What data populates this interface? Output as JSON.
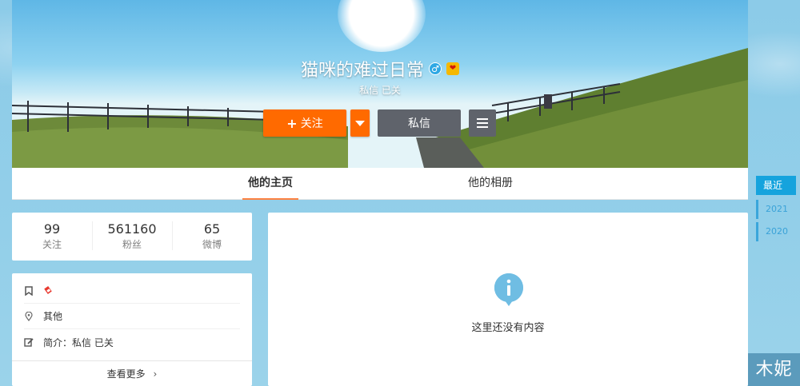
{
  "profile": {
    "name": "猫咪的难过日常",
    "intro": "私信 已关",
    "gender_icon": "male-icon",
    "badge_icon": "vip-badge-icon"
  },
  "actions": {
    "follow_label": "关注",
    "follow_plus": "+",
    "message_label": "私信"
  },
  "tabs": [
    {
      "label": "他的主页",
      "active": true
    },
    {
      "label": "他的相册",
      "active": false
    }
  ],
  "stats": [
    {
      "num": "99",
      "label": "关注"
    },
    {
      "num": "561160",
      "label": "粉丝"
    },
    {
      "num": "65",
      "label": "微博"
    }
  ],
  "info": {
    "location": "其他",
    "bio_label": "简介：",
    "bio_value": "私信 已关",
    "more_label": "查看更多",
    "more_chevron": "›"
  },
  "feed": {
    "empty_text": "这里还没有内容"
  },
  "years": [
    "最近",
    "2021",
    "2020"
  ],
  "corner_text": "木妮",
  "colors": {
    "accent_orange": "#ff6a00",
    "button_gray": "#5f636b",
    "year_blue": "#15a3dd"
  }
}
